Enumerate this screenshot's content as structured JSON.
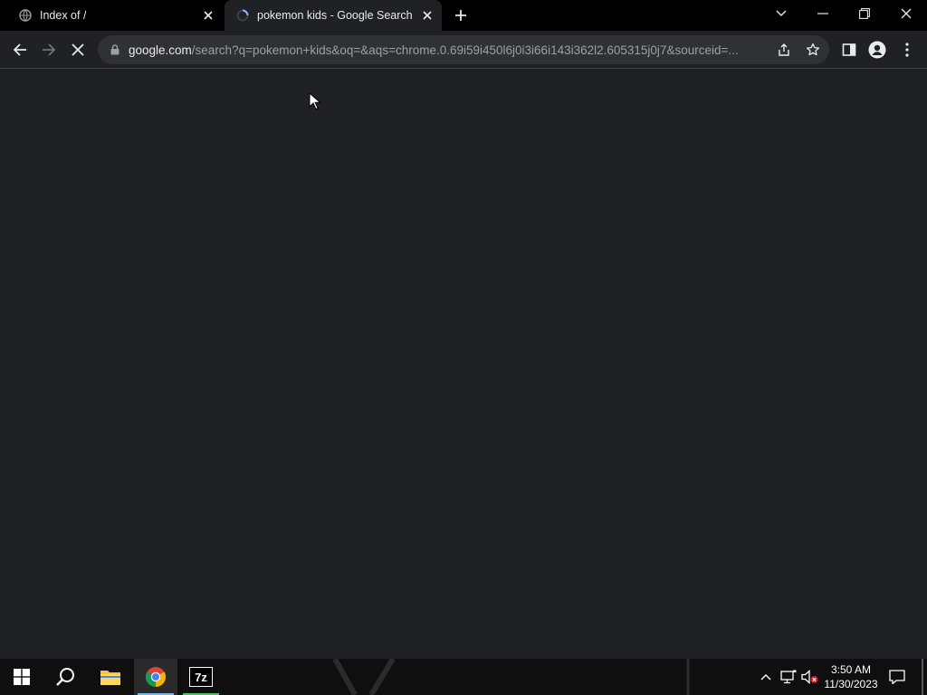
{
  "browser": {
    "tabs": [
      {
        "title": "Index of /",
        "active": false,
        "favicon": "globe-icon"
      },
      {
        "title": "pokemon kids - Google Search",
        "active": true,
        "favicon": "loading-spinner-icon"
      }
    ],
    "address": {
      "host": "google.com",
      "path": "/search?q=pokemon+kids&oq=&aqs=chrome.0.69i59i450l6j0i3i66i143i362l2.605315j0j7&sourceid=..."
    },
    "loading": true
  },
  "taskbar": {
    "apps": [
      "start-icon",
      "search-icon",
      "file-explorer-icon",
      "chrome-icon",
      "7zip-icon"
    ],
    "clock": {
      "time": "3:50 AM",
      "date": "11/30/2023"
    },
    "sevenzip_label": "7z"
  },
  "colors": {
    "tabstrip": "#000000",
    "page_bg": "#202124",
    "omnibox_bg": "#303134",
    "taskbar_bg": "#0f0f0f",
    "accent_blue": "#8ab4f8",
    "active_app_underline": "#76b9ed"
  }
}
